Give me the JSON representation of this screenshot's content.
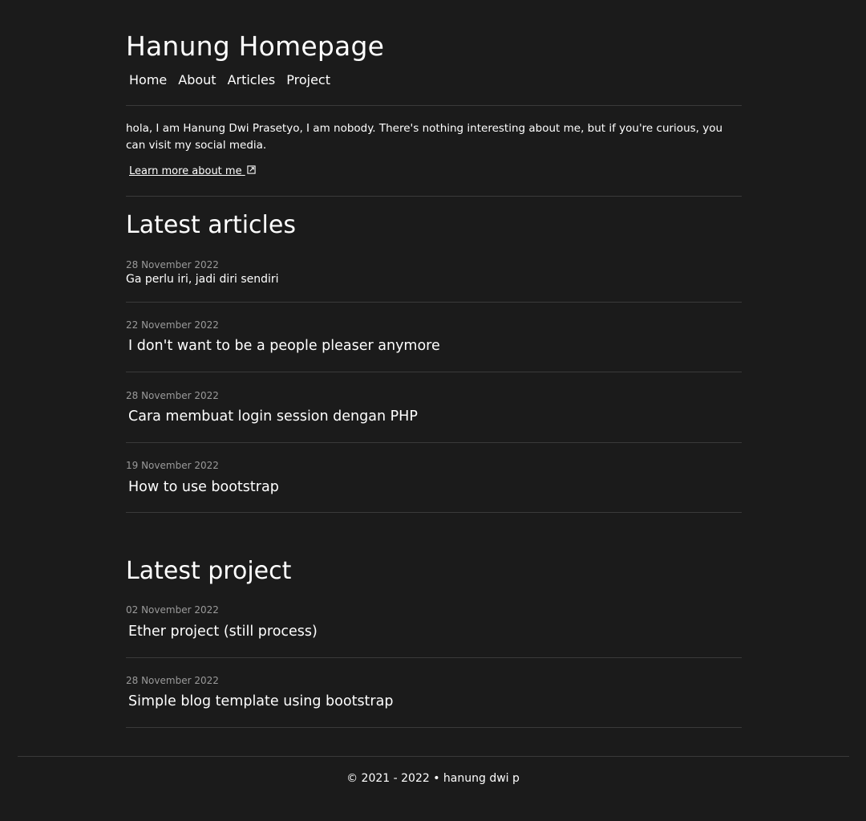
{
  "site": {
    "title": "Hanung Homepage"
  },
  "nav": {
    "items": [
      "Home",
      "About",
      "Articles",
      "Project"
    ]
  },
  "intro": {
    "text": "hola, I am Hanung Dwi Prasetyo, I am nobody. There's nothing interesting about me, but if you're curious, you can visit my social media.",
    "link_label": "Learn more about me",
    "link_icon": "external-link-icon"
  },
  "articles": {
    "heading": "Latest articles",
    "items": [
      {
        "date": "28 November 2022",
        "title": "Ga perlu iri, jadi diri sendiri"
      },
      {
        "date": "22 November 2022",
        "title": "I don't want to be a people pleaser anymore"
      },
      {
        "date": "28 November 2022",
        "title": "Cara membuat login session dengan PHP"
      },
      {
        "date": "19 November 2022",
        "title": "How to use bootstrap"
      }
    ]
  },
  "projects": {
    "heading": "Latest project",
    "items": [
      {
        "date": "02 November 2022",
        "title": "Ether project (still process)"
      },
      {
        "date": "28 November 2022",
        "title": "Simple blog template using bootstrap"
      }
    ]
  },
  "footer": {
    "text": "© 2021 - 2022 • hanung dwi p"
  },
  "colors": {
    "background": "#1b1b1b",
    "text": "#ffffff",
    "muted": "#9a9a9a",
    "divider": "#3a3a3a"
  }
}
